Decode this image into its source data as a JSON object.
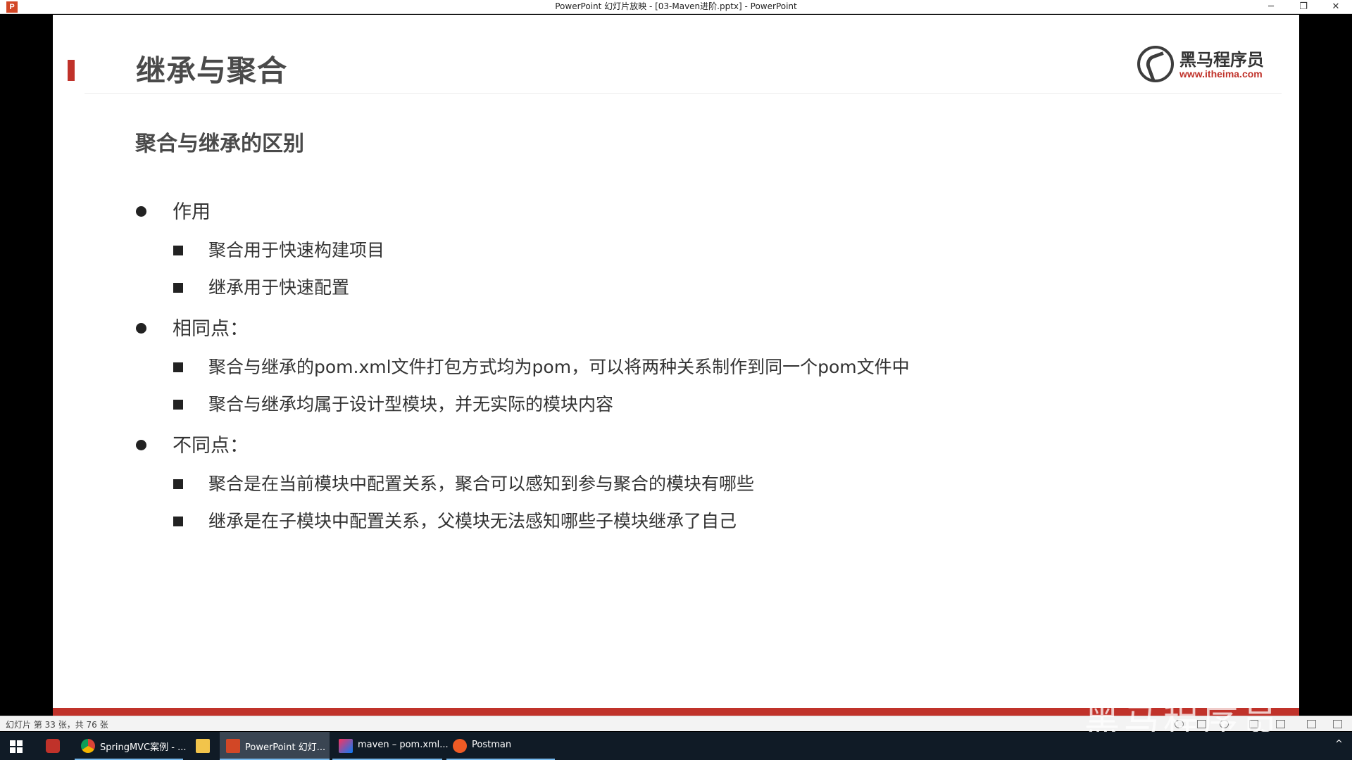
{
  "window": {
    "title": "PowerPoint 幻灯片放映 - [03-Maven进阶.pptx] - PowerPoint",
    "app_icon": "P",
    "controls": [
      "─",
      "❐",
      "✕"
    ]
  },
  "slide": {
    "title": "继承与聚合",
    "logo": {
      "name": "黑马程序员",
      "url": "www.itheima.com"
    },
    "subtitle": "聚合与继承的区别",
    "sections": [
      {
        "heading": "作用",
        "items": [
          "聚合用于快速构建项目",
          "继承用于快速配置"
        ]
      },
      {
        "heading": "相同点：",
        "items": [
          "聚合与继承的pom.xml文件打包方式均为pom，可以将两种关系制作到同一个pom文件中",
          "聚合与继承均属于设计型模块，并无实际的模块内容"
        ]
      },
      {
        "heading": "不同点：",
        "items": [
          "聚合是在当前模块中配置关系，聚合可以感知到参与聚合的模块有哪些",
          "继承是在子模块中配置关系，父模块无法感知哪些子模块继承了自己"
        ]
      }
    ],
    "accent_color": "#c0322a"
  },
  "statusbar": {
    "text": "幻灯片 第 33 张，共 76 张"
  },
  "watermark": "黑马程序员",
  "taskbar": {
    "items": [
      {
        "label": "SpringMVC案例 - ...",
        "icon": "chrome-icon"
      },
      {
        "label": "PowerPoint 幻灯...",
        "icon": "powerpoint-icon",
        "active": true
      },
      {
        "label": "maven – pom.xml...",
        "icon": "intellij-icon"
      },
      {
        "label": "Postman",
        "icon": "postman-icon"
      }
    ],
    "tray_arrow": "^"
  }
}
